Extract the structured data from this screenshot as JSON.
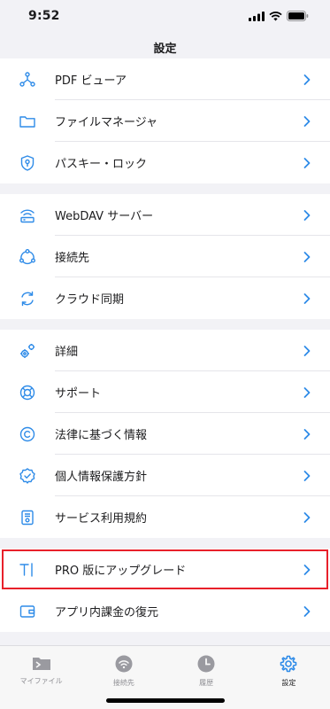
{
  "status": {
    "time": "9:52"
  },
  "nav": {
    "title": "設定"
  },
  "groups": [
    {
      "items": [
        {
          "label": "PDF ビューア",
          "icon": "pdf-viewer-icon"
        },
        {
          "label": "ファイルマネージャ",
          "icon": "folder-icon"
        },
        {
          "label": "パスキー・ロック",
          "icon": "shield-key-icon"
        }
      ]
    },
    {
      "items": [
        {
          "label": "WebDAV サーバー",
          "icon": "wifi-server-icon"
        },
        {
          "label": "接続先",
          "icon": "connections-icon"
        },
        {
          "label": "クラウド同期",
          "icon": "sync-icon"
        }
      ]
    },
    {
      "items": [
        {
          "label": "詳細",
          "icon": "gears-icon"
        },
        {
          "label": "サポート",
          "icon": "lifebuoy-icon"
        },
        {
          "label": "法律に基づく情報",
          "icon": "copyright-icon"
        },
        {
          "label": "個人情報保護方針",
          "icon": "privacy-badge-icon"
        },
        {
          "label": "サービス利用規約",
          "icon": "terms-document-icon"
        }
      ]
    },
    {
      "items": [
        {
          "label": "PRO 版にアップグレード",
          "icon": "text-cursor-icon",
          "highlighted": true
        },
        {
          "label": "アプリ内課金の復元",
          "icon": "wallet-icon"
        }
      ]
    }
  ],
  "tabs": [
    {
      "label": "マイファイル",
      "icon": "my-files-icon",
      "active": false
    },
    {
      "label": "接続先",
      "icon": "connections-tab-icon",
      "active": false
    },
    {
      "label": "履歴",
      "icon": "history-clock-icon",
      "active": false
    },
    {
      "label": "設定",
      "icon": "settings-gear-icon",
      "active": true
    }
  ],
  "colors": {
    "accent": "#2e8be8",
    "highlight": "#e8202a",
    "background": "#f2f2f6"
  }
}
